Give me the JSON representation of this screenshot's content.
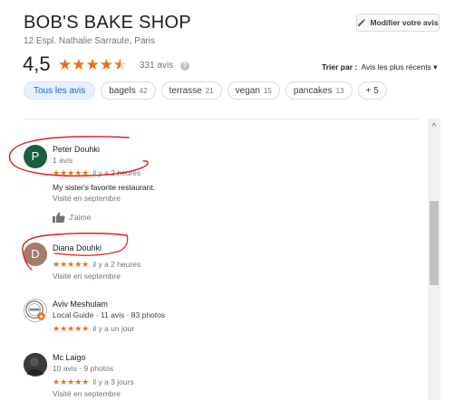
{
  "business": {
    "name": "BOB'S BAKE SHOP",
    "address": "12 Espl. Nathalie Sarraute, Paris"
  },
  "edit_button": {
    "label": "Modifier votre avis",
    "icon": "pencil-icon"
  },
  "summary": {
    "rating": "4,5",
    "rating_value": 4.5,
    "stars": "★★★★",
    "count": "331 avis",
    "help_icon": "?"
  },
  "sort": {
    "label": "Trier par :",
    "value": "Avis les plus récents",
    "caret": "▾"
  },
  "chips": [
    {
      "label": "Tous les avis",
      "count": ""
    },
    {
      "label": "bagels",
      "count": "42"
    },
    {
      "label": "terrasse",
      "count": "21"
    },
    {
      "label": "vegan",
      "count": "15"
    },
    {
      "label": "pancakes",
      "count": "13"
    },
    {
      "label": "+ 5",
      "count": ""
    }
  ],
  "scroll_up": "^",
  "reviews": [
    {
      "initial": "P",
      "name": "Peter Douhki",
      "sub": "1 avis",
      "stars": "★★★★★",
      "when": "il y a 2 heures",
      "text": "My sister's favorite restaurant.",
      "visit": "Visité en septembre",
      "like": "J'aime",
      "avatar_color": "#1b5e3f"
    },
    {
      "initial": "D",
      "name": "Diana Douhki",
      "sub": "",
      "stars": "★★★★★",
      "when": "il y a 2 heures",
      "text": "",
      "visit": "Visité en septembre",
      "like": "",
      "avatar_color": "#a07c6a"
    },
    {
      "initial": "",
      "name": "Aviv Meshulam",
      "sub": "Local Guide · 11 avis · 83 photos",
      "stars": "★★★★★",
      "when": "il y a un jour",
      "text": "",
      "visit": "",
      "like": "",
      "avatar_color": "#d9d9d9"
    },
    {
      "initial": "",
      "name": "Mc Laigo",
      "sub": "10 avis · 9 photos",
      "stars": "★★★★★",
      "when": "il y a 3 jours",
      "text": "",
      "visit": "Visité en septembre",
      "like": "",
      "avatar_color": "#333333"
    }
  ],
  "colors": {
    "star": "#e7711b",
    "chip_active_bg": "#e8f0fe",
    "chip_active_text": "#1967d2",
    "annotation": "#e02020"
  }
}
